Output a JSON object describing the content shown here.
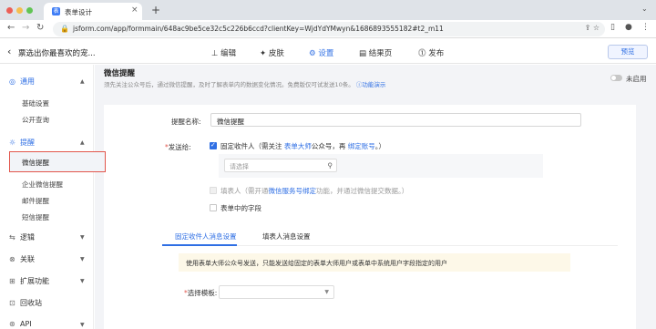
{
  "browser": {
    "tab_title": "表单设计",
    "tab_favicon": "表",
    "address": "jsform.com/app/formmain/648ac9be5ce32c5c226b6ccd?clientKey=WjdYdYMwyn&1686893555182#t2_m11"
  },
  "header": {
    "form_title": "票选出你最喜欢的宠...",
    "nav": [
      {
        "label": "编辑",
        "icon": "edit-icon"
      },
      {
        "label": "皮肤",
        "icon": "skin-icon"
      },
      {
        "label": "设置",
        "icon": "settings-icon"
      },
      {
        "label": "结果页",
        "icon": "result-page-icon"
      },
      {
        "label": "发布",
        "icon": "publish-icon"
      }
    ],
    "active_nav": "设置",
    "preview_label": "预览"
  },
  "sidebar": {
    "general": {
      "label": "通用",
      "items": [
        "基础设置",
        "公开查询"
      ]
    },
    "remind": {
      "label": "提醒",
      "items": [
        "微信提醒",
        "企业微信提醒",
        "邮件提醒",
        "短信提醒"
      ],
      "active": "微信提醒"
    },
    "bottom": [
      {
        "label": "逻辑",
        "icon": "logic-icon"
      },
      {
        "label": "关联",
        "icon": "link-icon"
      },
      {
        "label": "扩展功能",
        "icon": "extension-icon"
      },
      {
        "label": "回收站",
        "icon": "trash-icon"
      },
      {
        "label": "API",
        "icon": "api-icon"
      }
    ]
  },
  "main": {
    "title": "微信提醒",
    "description": "须先关注公众号后，通过微信提醒，及时了解表单内的数据变化情况。免费版仅可试发送10条。",
    "demo_link": "功能演示",
    "toggle_label": "未启用",
    "toggle_on": false,
    "name_label": "提醒名称:",
    "name_value": "微信提醒",
    "send_to_label": "发送给:",
    "fixed_recipient": {
      "checked": true,
      "label": "固定收件人（需关注",
      "link1": "表单大师",
      "mid": "公众号，再",
      "link2": "绑定账号",
      "end": "。）"
    },
    "recipient_placeholder": "请选择",
    "filler": {
      "checked": false,
      "label": "填表人（需开通",
      "link": "微信服务号绑定",
      "end": "功能，并通过微信提交数据。）"
    },
    "form_field": {
      "checked": false,
      "label": "表单中的字段"
    },
    "tabs": [
      "固定收件人消息设置",
      "填表人消息设置"
    ],
    "active_tab": "固定收件人消息设置",
    "info": "使用表单大师公众号发送，只能发送给固定的表单大师用户或表单中系统用户字段指定的用户",
    "template_label": "选择模板:"
  }
}
